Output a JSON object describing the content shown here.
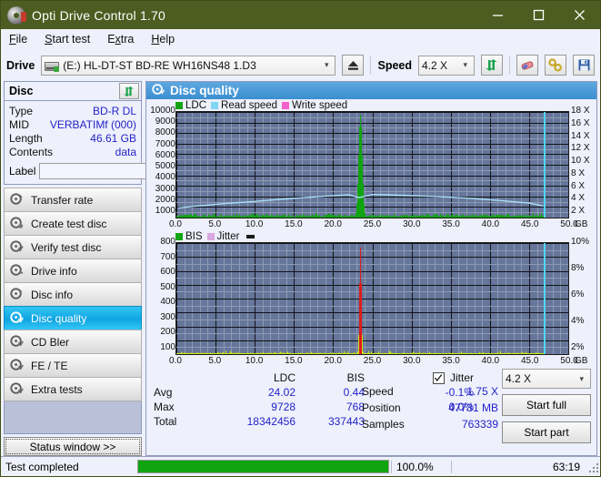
{
  "window": {
    "title": "Opti Drive Control 1.70",
    "icon": "disc-icon",
    "minimize": "minimize-icon",
    "maximize": "maximize-icon",
    "close": "close-icon"
  },
  "menu": [
    {
      "label": "File",
      "accel": "F"
    },
    {
      "label": "Start test",
      "accel": "S"
    },
    {
      "label": "Extra",
      "accel": "x"
    },
    {
      "label": "Help",
      "accel": "H"
    }
  ],
  "toolbar": {
    "drive_label": "Drive",
    "drive_value": "(E:)  HL-DT-ST BD-RE  WH16NS48 1.D3",
    "eject_icon": "eject-icon",
    "speed_label": "Speed",
    "speed_value": "4.2 X",
    "refresh_icon": "refresh-icon",
    "erase_icon": "eraser-icon",
    "tools_icon": "wrench-icon",
    "save_icon": "save-icon",
    "chevron": "chevron-down-icon"
  },
  "disc": {
    "header": "Disc",
    "refresh_icon": "refresh-icon",
    "rows": [
      {
        "key": "Type",
        "value": "BD-R DL"
      },
      {
        "key": "MID",
        "value": "VERBATIMf (000)"
      },
      {
        "key": "Length",
        "value": "46.61 GB"
      },
      {
        "key": "Contents",
        "value": "data"
      }
    ],
    "label_key": "Label",
    "label_value": "",
    "label_placeholder": "",
    "disc_button_icon": "cd-icon"
  },
  "nav": {
    "items": [
      {
        "label": "Transfer rate",
        "icon": "disc-speed-icon",
        "active": false
      },
      {
        "label": "Create test disc",
        "icon": "disc-burn-icon",
        "active": false
      },
      {
        "label": "Verify test disc",
        "icon": "disc-check-icon",
        "active": false
      },
      {
        "label": "Drive info",
        "icon": "drive-info-icon",
        "active": false
      },
      {
        "label": "Disc info",
        "icon": "disc-info-icon",
        "active": false
      },
      {
        "label": "Disc quality",
        "icon": "disc-quality-icon",
        "active": true
      },
      {
        "label": "CD Bler",
        "icon": "disc-bler-icon",
        "active": false
      },
      {
        "label": "FE / TE",
        "icon": "disc-fete-icon",
        "active": false
      },
      {
        "label": "Extra tests",
        "icon": "disc-extra-icon",
        "active": false
      }
    ],
    "status_window": "Status window >>"
  },
  "panel": {
    "title": "Disc quality",
    "icon": "disc-quality-icon"
  },
  "chart_data": [
    {
      "id": "top-chart",
      "type": "line",
      "title": "",
      "xlabel": "GB",
      "ylabel": "",
      "xlim": [
        0,
        50
      ],
      "xticks": [
        0.0,
        5.0,
        10.0,
        15.0,
        20.0,
        25.0,
        30.0,
        35.0,
        40.0,
        45.0,
        50.0
      ],
      "xticklabels": [
        "0.0",
        "5.0",
        "10.0",
        "15.0",
        "20.0",
        "25.0",
        "30.0",
        "35.0",
        "40.0",
        "45.0",
        "50.0"
      ],
      "xunit": "GB",
      "ylim": [
        0,
        10000
      ],
      "yticks": [
        1000,
        2000,
        3000,
        4000,
        5000,
        6000,
        7000,
        8000,
        9000,
        10000
      ],
      "yticklabels": [
        "1000",
        "2000",
        "3000",
        "4000",
        "5000",
        "6000",
        "7000",
        "8000",
        "9000",
        "10000"
      ],
      "y2lim": [
        0,
        19
      ],
      "y2ticks": [
        2,
        4,
        6,
        8,
        10,
        12,
        14,
        16,
        18
      ],
      "y2ticklabels": [
        "2 X",
        "4 X",
        "6 X",
        "8 X",
        "10 X",
        "12 X",
        "14 X",
        "16 X",
        "18 X"
      ],
      "grid": true,
      "legend": [
        {
          "name": "LDC",
          "color": "#11a411"
        },
        {
          "name": "Read speed",
          "color": "#7fd5f4"
        },
        {
          "name": "Write speed",
          "color": "#f562c9"
        }
      ],
      "series": [
        {
          "name": "Read speed",
          "color": "#a9dff5",
          "type": "line",
          "x": [
            0.2,
            2.0,
            4.0,
            6.0,
            8.0,
            10.0,
            12.0,
            14.0,
            16.0,
            18.0,
            20.0,
            22.0,
            23.3,
            25.0,
            27.0,
            29.0,
            31.0,
            33.0,
            35.0,
            37.0,
            39.0,
            41.0,
            43.0,
            45.0,
            46.8
          ],
          "y": [
            1.7,
            2.0,
            2.25,
            2.5,
            2.7,
            2.9,
            3.15,
            3.35,
            3.55,
            3.75,
            3.95,
            4.1,
            3.6,
            4.15,
            4.1,
            4.0,
            3.9,
            3.8,
            3.65,
            3.5,
            3.3,
            3.1,
            2.85,
            2.6,
            2.1
          ]
        },
        {
          "name": "LDC",
          "color": "#11a411",
          "type": "bars",
          "peak_x": 23.4,
          "peak_y": 9728,
          "noise_mean": 180,
          "noise_max": 420
        }
      ],
      "markers": [
        {
          "name": "end-of-data",
          "x": 46.9,
          "color": "#4fd8f7"
        }
      ]
    },
    {
      "id": "bottom-chart",
      "type": "bar",
      "title": "",
      "xlabel": "GB",
      "xlim": [
        0,
        50
      ],
      "xticks": [
        0.0,
        5.0,
        10.0,
        15.0,
        20.0,
        25.0,
        30.0,
        35.0,
        40.0,
        45.0,
        50.0
      ],
      "xticklabels": [
        "0.0",
        "5.0",
        "10.0",
        "15.0",
        "20.0",
        "25.0",
        "30.0",
        "35.0",
        "40.0",
        "45.0",
        "50.0"
      ],
      "xunit": "GB",
      "ylim": [
        0,
        800
      ],
      "yticks": [
        100,
        200,
        300,
        400,
        500,
        600,
        700,
        800
      ],
      "yticklabels": [
        "100",
        "200",
        "300",
        "400",
        "500",
        "600",
        "700",
        "800"
      ],
      "y2lim": [
        0,
        10
      ],
      "y2ticks": [
        2,
        4,
        6,
        8,
        10
      ],
      "y2ticklabels": [
        "2%",
        "4%",
        "6%",
        "8%",
        "10%"
      ],
      "grid": true,
      "legend": [
        {
          "name": "BIS",
          "color": "#11a411"
        },
        {
          "name": "Jitter",
          "color": "#d9a8e0"
        }
      ],
      "series": [
        {
          "name": "BIS",
          "color": "#c8e614",
          "type": "bars",
          "peak_x": 23.4,
          "peak_y": 768,
          "peak_color": "#e01b1b",
          "noise_mean": 6,
          "noise_max": 22
        }
      ],
      "markers": [
        {
          "name": "end-of-data",
          "x": 46.9,
          "color": "#4fd8f7"
        }
      ]
    }
  ],
  "stats": {
    "headers": {
      "ldc": "LDC",
      "bis": "BIS",
      "jitter": "Jitter"
    },
    "jitter_checked": true,
    "rows": [
      {
        "label": "Avg",
        "ldc": "24.02",
        "bis": "0.44",
        "jitter": "-0.1%"
      },
      {
        "label": "Max",
        "ldc": "9728",
        "bis": "768",
        "jitter": "0.0%"
      },
      {
        "label": "Total",
        "ldc": "18342456",
        "bis": "337443",
        "jitter": ""
      }
    ],
    "right": [
      {
        "key": "Speed",
        "value": "1.75 X"
      },
      {
        "key": "Position",
        "value": "47731 MB"
      },
      {
        "key": "Samples",
        "value": "763339"
      }
    ],
    "speed_select": "4.2 X",
    "start_full": "Start full",
    "start_part": "Start part"
  },
  "statusbar": {
    "text": "Test completed",
    "progress_pct": 100,
    "progress_label": "100.0%",
    "elapsed": "63:19"
  },
  "colors": {
    "titlebar": "#4b5d20",
    "accent_blue": "#2323c8",
    "plot_bg": "#66769a",
    "ldc_green": "#11a411",
    "read_speed": "#a9dff5",
    "marker_cyan": "#4fd8f7",
    "bis_red": "#e01b1b",
    "panel_header": "#3b8ed0"
  }
}
